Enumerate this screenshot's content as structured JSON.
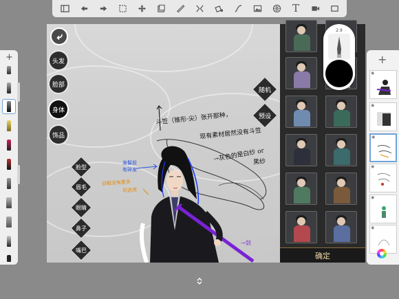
{
  "toolbar": {
    "items": [
      "gallery-icon",
      "undo-icon",
      "redo-icon",
      "selection-icon",
      "transform-icon",
      "layer-icon",
      "ruler-icon",
      "symmetry-icon",
      "fill-icon",
      "curve-icon",
      "image-icon",
      "perspective-icon",
      "text-icon",
      "video-icon",
      "fullscreen-icon"
    ],
    "text_tool_label": "T"
  },
  "brush_panel": {
    "add": "+",
    "selected_index": 2
  },
  "canvas": {
    "nav_buttons": [
      "头发",
      "脸部",
      "身体",
      "饰品"
    ],
    "active_nav": "身体",
    "face_parts": [
      "脸型",
      "眉毛",
      "眼睛",
      "鼻子",
      "嘴巴"
    ],
    "side_buttons": [
      "随机",
      "预设"
    ],
    "annotations": {
      "hat_note_line1": "斗笠（锥形·尖）张开那种，",
      "hat_note_line2": "现有素材居然没有斗笠",
      "veil_note_line1": "→灰色的是白纱 or",
      "veil_note_line2": "黑纱",
      "blue_note_line1": "发髻前",
      "blue_note_line2": "有碎发",
      "orange_note_line1": "白鞋没有更多",
      "orange_note_line2": "可选项",
      "sword_note": "→剑"
    }
  },
  "character_panel": {
    "confirm": "确定"
  },
  "brush_size": {
    "value": "2.9"
  },
  "layers_panel": {
    "add": "+"
  },
  "colors": {
    "toolbar_bg": "#e9e9e9",
    "accent_selected": "#6ea3d8",
    "confirm_text": "#efd9a8"
  }
}
